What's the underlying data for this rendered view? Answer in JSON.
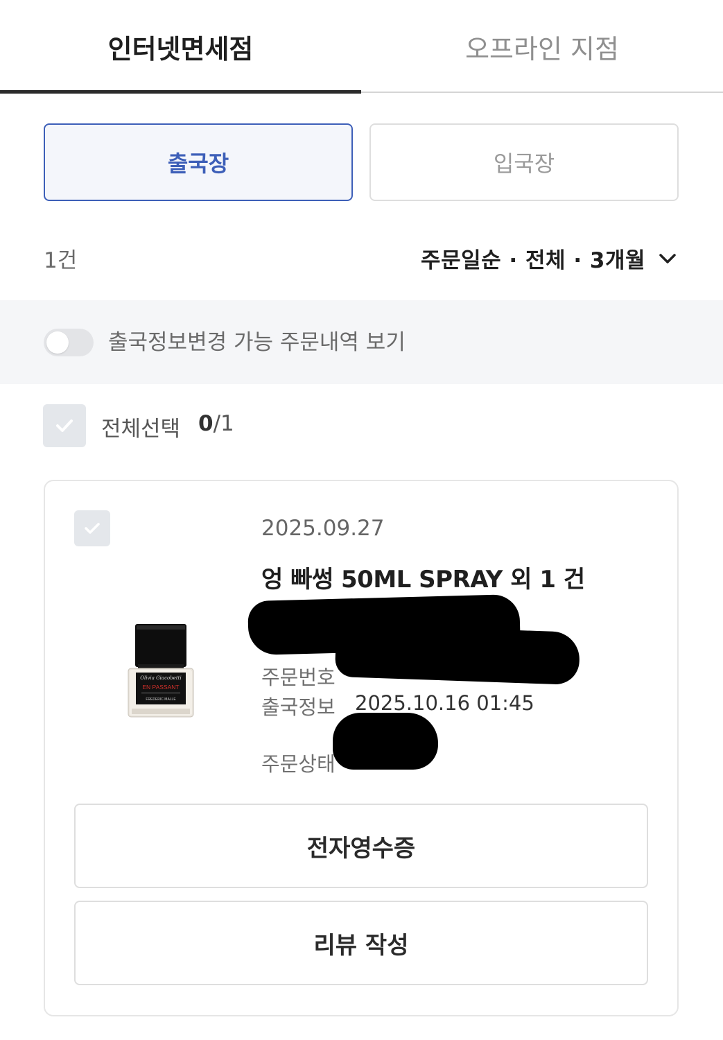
{
  "tabs": {
    "online": "인터넷면세점",
    "offline": "오프라인 지점"
  },
  "segments": {
    "departure": "출국장",
    "arrival": "입국장"
  },
  "filter": {
    "count": "1건",
    "sort": "주문일순 · 전체 · 3개월"
  },
  "toggle": {
    "label": "출국정보변경 가능 주문내역 보기",
    "state": "off"
  },
  "select_all": {
    "label": "전체선택",
    "selected": "0",
    "total": "/1"
  },
  "order": {
    "date": "2025.09.27",
    "product_name": "엉 빠썽 50ML SPRAY 외 1 건",
    "order_number_label": "주문번호",
    "departure_label": "출국정보",
    "departure_value": "2025.10.16 01:45",
    "status_label": "주문상태",
    "bottle_brand": "Olivia Giacobetti",
    "bottle_name": "EN PASSANT",
    "bottle_maker": "FREDERIC MALLE",
    "receipt_button": "전자영수증",
    "review_button": "리뷰 작성"
  },
  "colors": {
    "accent": "#3d5fb8",
    "checkbox_bg": "#e4e7eb",
    "band_bg": "#f5f6f8"
  }
}
